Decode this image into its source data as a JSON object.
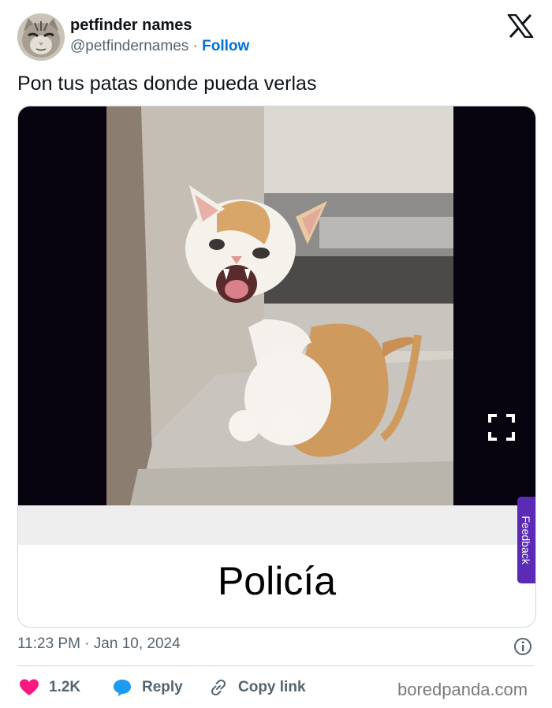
{
  "author": {
    "display_name": "petfinder names",
    "handle": "@petfindernames",
    "separator": "·",
    "follow_label": "Follow"
  },
  "tweet": {
    "text": "Pon tus patas donde pueda verlas",
    "caption": "Policía",
    "timestamp": "11:23 PM · Jan 10, 2024"
  },
  "card": {
    "feedback_label": "Feedback"
  },
  "actions": {
    "like_count": "1.2K",
    "reply_label": "Reply",
    "copy_label": "Copy link"
  },
  "watermark": "boredpanda.com",
  "colors": {
    "follow": "#006fd6",
    "like": "#f91880",
    "reply": "#1d9bf0",
    "feedback": "#5b2bb5",
    "secondary_text": "#536471"
  },
  "icons": [
    "x-logo-icon",
    "expand-icon",
    "info-icon",
    "heart-icon",
    "reply-bubble-icon",
    "link-icon"
  ]
}
